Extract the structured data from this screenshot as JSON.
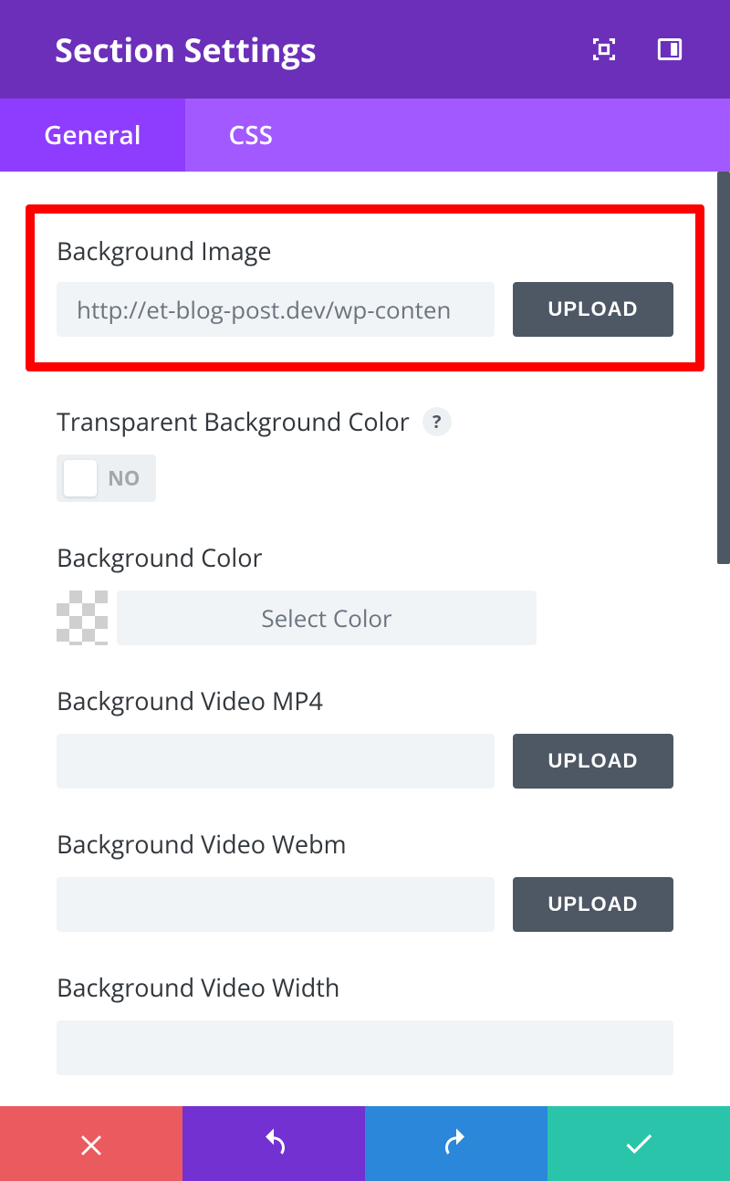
{
  "header": {
    "title": "Section Settings"
  },
  "tabs": {
    "general": "General",
    "css": "CSS"
  },
  "fields": {
    "bg_image": {
      "label": "Background Image",
      "value": "http://et-blog-post.dev/wp-conten",
      "upload": "UPLOAD"
    },
    "transparent": {
      "label": "Transparent Background Color",
      "help": "?",
      "toggle_state": "NO"
    },
    "bg_color": {
      "label": "Background Color",
      "select": "Select Color"
    },
    "video_mp4": {
      "label": "Background Video MP4",
      "value": "",
      "upload": "UPLOAD"
    },
    "video_webm": {
      "label": "Background Video Webm",
      "value": "",
      "upload": "UPLOAD"
    },
    "video_width": {
      "label": "Background Video Width",
      "value": ""
    }
  }
}
